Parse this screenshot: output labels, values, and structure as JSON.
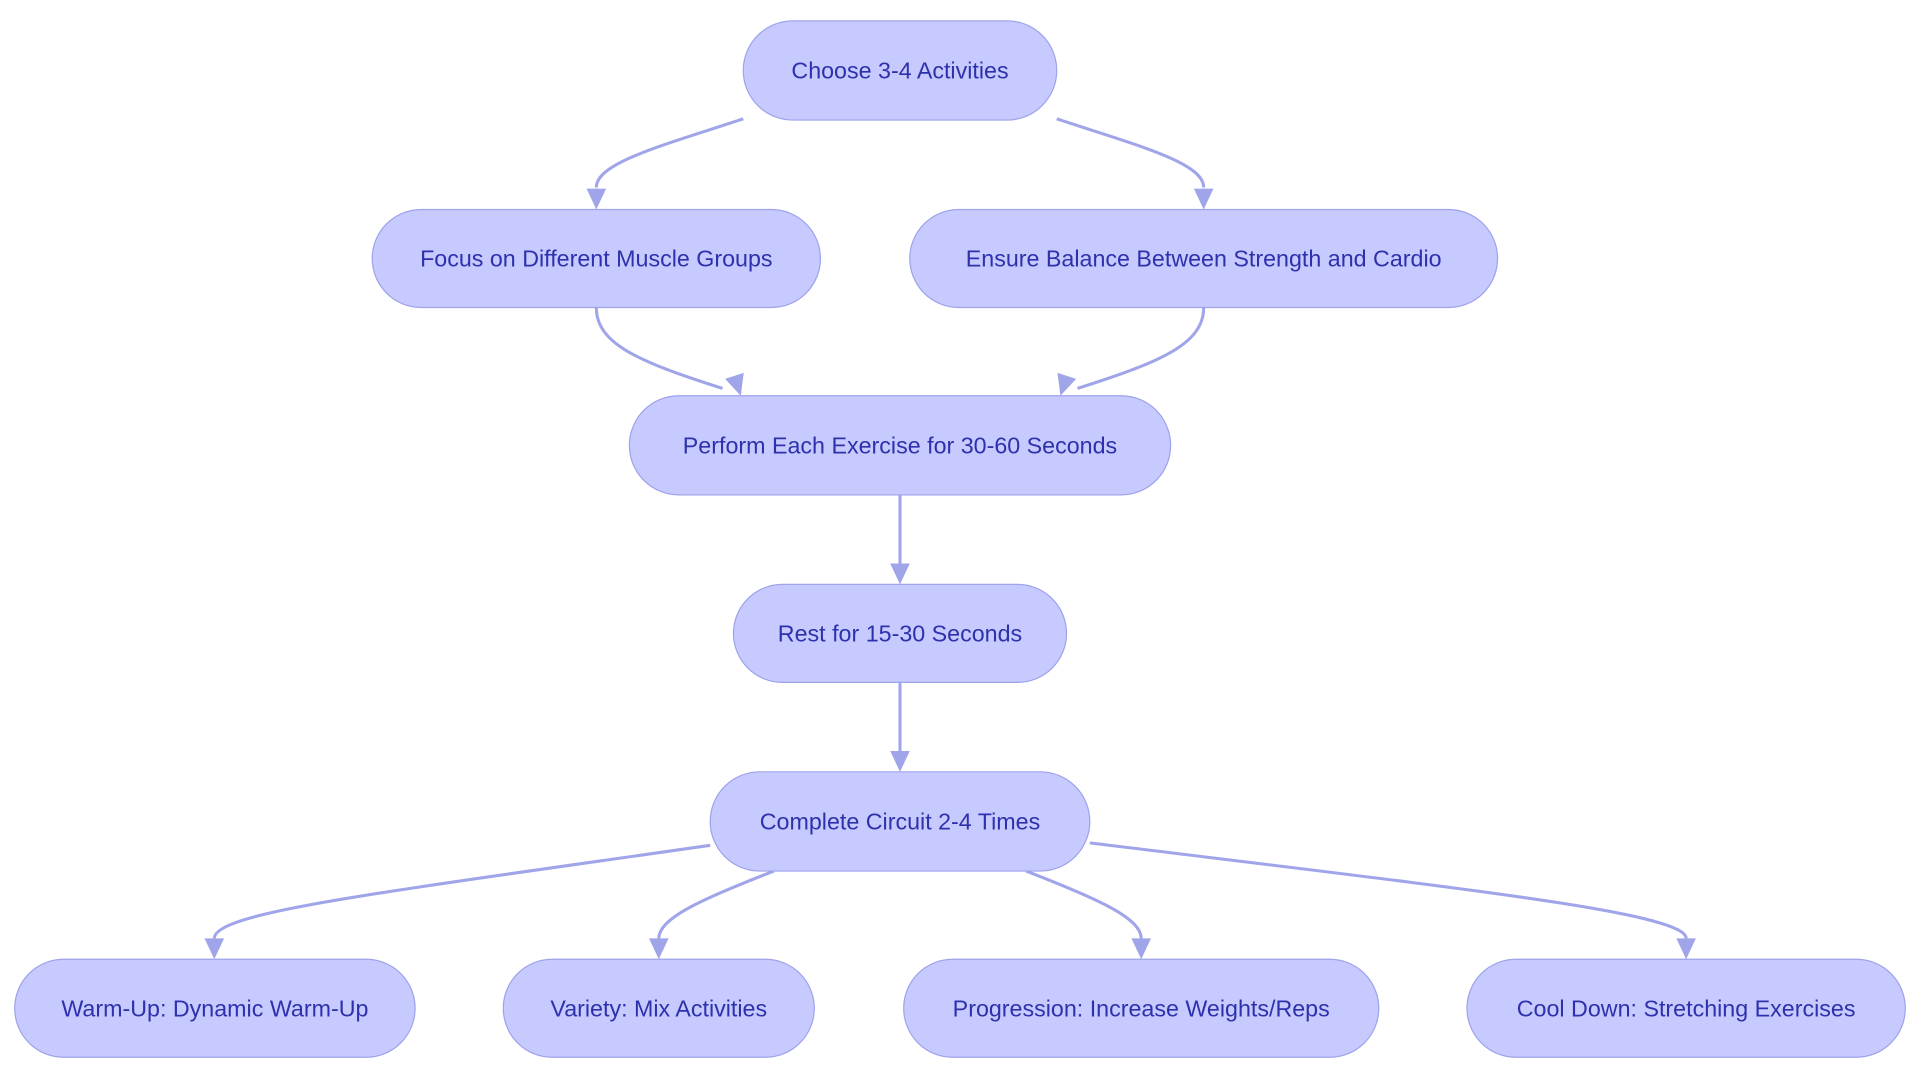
{
  "diagram": {
    "type": "flowchart",
    "colors": {
      "node_fill": "#c7caff",
      "node_stroke": "#9ea3ea",
      "text": "#2d31ab",
      "edge": "#a0a5ea"
    },
    "nodes": [
      {
        "id": "choose",
        "label": "Choose 3-4 Activities"
      },
      {
        "id": "focus",
        "label": "Focus on Different Muscle Groups"
      },
      {
        "id": "balance",
        "label": "Ensure Balance Between Strength and Cardio"
      },
      {
        "id": "perform",
        "label": "Perform Each Exercise for 30-60 Seconds"
      },
      {
        "id": "rest",
        "label": "Rest for 15-30 Seconds"
      },
      {
        "id": "complete",
        "label": "Complete Circuit 2-4 Times"
      },
      {
        "id": "warmup",
        "label": "Warm-Up: Dynamic Warm-Up"
      },
      {
        "id": "variety",
        "label": "Variety: Mix Activities"
      },
      {
        "id": "progression",
        "label": "Progression: Increase Weights/Reps"
      },
      {
        "id": "cooldown",
        "label": "Cool Down: Stretching Exercises"
      }
    ],
    "edges": [
      {
        "from": "choose",
        "to": "focus"
      },
      {
        "from": "choose",
        "to": "balance"
      },
      {
        "from": "focus",
        "to": "perform"
      },
      {
        "from": "balance",
        "to": "perform"
      },
      {
        "from": "perform",
        "to": "rest"
      },
      {
        "from": "rest",
        "to": "complete"
      },
      {
        "from": "complete",
        "to": "warmup"
      },
      {
        "from": "complete",
        "to": "variety"
      },
      {
        "from": "complete",
        "to": "progression"
      },
      {
        "from": "complete",
        "to": "cooldown"
      }
    ]
  }
}
